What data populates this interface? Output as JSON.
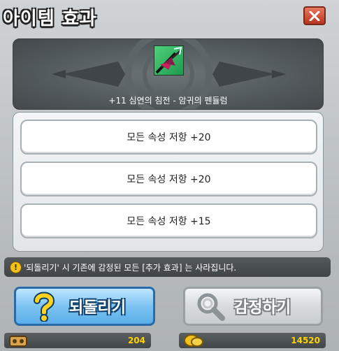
{
  "window": {
    "title": "아이템 효과"
  },
  "item": {
    "name": "+11 심연의 침전 - 암귀의 펜듈럼"
  },
  "effects": [
    {
      "label": "모든 속성 저항 +20"
    },
    {
      "label": "모든 속성 저항 +20"
    },
    {
      "label": "모든 속성 저항 +15"
    }
  ],
  "warning": {
    "text": "'되돌리기' 시 기존에 감정된 모든 [추가 효과] 는 사라집니다."
  },
  "buttons": {
    "revert": "되돌리기",
    "appraise": "감정하기"
  },
  "currency": {
    "left": {
      "icon": "reward-box-icon",
      "value": "204"
    },
    "right": {
      "icon": "gold-coin-icon",
      "value": "14520"
    }
  },
  "colors": {
    "revert_button": "#7cc3f2",
    "appraise_button": "#d7dbde",
    "close_button": "#c84a30",
    "currency_text": "#ffd200"
  }
}
